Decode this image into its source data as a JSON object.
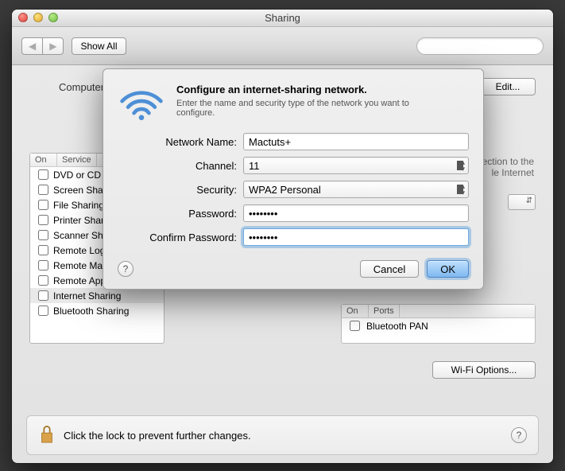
{
  "window": {
    "title": "Sharing"
  },
  "toolbar": {
    "back": "◀",
    "forward": "▶",
    "showAll": "Show All",
    "searchPlaceholder": ""
  },
  "computerName": {
    "label": "Computer Name:",
    "edit": "Edit..."
  },
  "services": {
    "header": {
      "on": "On",
      "service": "Service"
    },
    "items": [
      {
        "on": false,
        "label": "DVD or CD Sharing"
      },
      {
        "on": false,
        "label": "Screen Sharing"
      },
      {
        "on": false,
        "label": "File Sharing"
      },
      {
        "on": false,
        "label": "Printer Sharing"
      },
      {
        "on": false,
        "label": "Scanner Sharing"
      },
      {
        "on": false,
        "label": "Remote Login"
      },
      {
        "on": false,
        "label": "Remote Management"
      },
      {
        "on": false,
        "label": "Remote Apple Events"
      },
      {
        "on": false,
        "label": "Internet Sharing",
        "selected": true
      },
      {
        "on": false,
        "label": "Bluetooth Sharing"
      }
    ]
  },
  "rightInfo": {
    "line1": "ection to the",
    "line2": "le Internet"
  },
  "ports": {
    "header": {
      "on": "On",
      "ports": "Ports"
    },
    "items": [
      {
        "on": false,
        "label": "Bluetooth PAN"
      }
    ]
  },
  "wifiOptions": "Wi-Fi Options...",
  "lock": {
    "text": "Click the lock to prevent further changes."
  },
  "sheet": {
    "title": "Configure an internet-sharing network.",
    "subtitle": "Enter the name and security type of the network you want to configure.",
    "labels": {
      "networkName": "Network Name:",
      "channel": "Channel:",
      "security": "Security:",
      "password": "Password:",
      "confirm": "Confirm Password:"
    },
    "values": {
      "networkName": "Mactuts+",
      "channel": "11",
      "security": "WPA2 Personal",
      "password": "••••••••",
      "confirm": "••••••••"
    },
    "buttons": {
      "cancel": "Cancel",
      "ok": "OK"
    }
  }
}
